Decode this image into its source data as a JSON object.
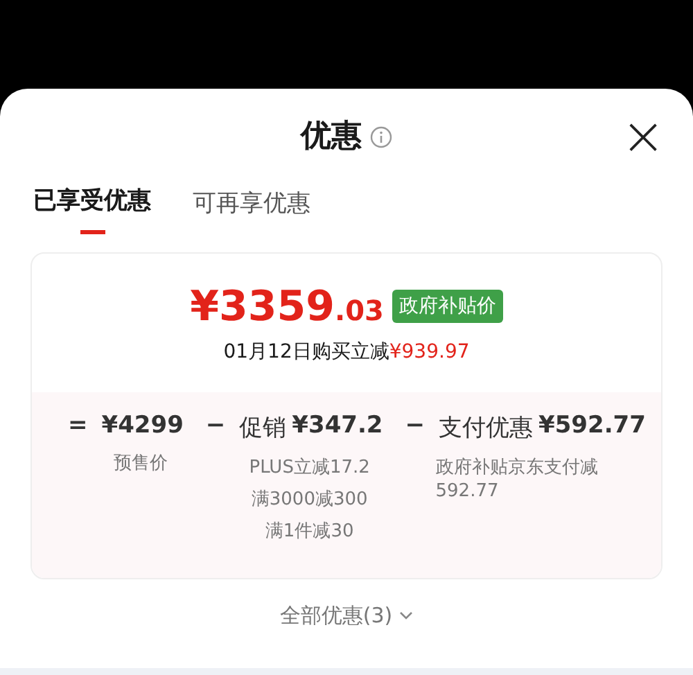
{
  "sheet": {
    "title": "优惠",
    "close": "×"
  },
  "tabs": [
    {
      "label": "已享受优惠",
      "selected": true
    },
    {
      "label": "可再享优惠",
      "selected": false
    }
  ],
  "summary": {
    "price": "¥3359",
    "price_decimal": ".03",
    "badge": "政府补贴价",
    "note": "01月12日购买立减",
    "saving": "¥939.97"
  },
  "breakdown": [
    {
      "operator": "=",
      "amount": "¥4299",
      "notes": [
        "预售价"
      ]
    },
    {
      "operator": "−",
      "label": "促销",
      "amount": "¥347.2",
      "notes": [
        "PLUS立减17.2",
        "满3000减300",
        "满1件减30"
      ]
    },
    {
      "operator": "−",
      "label": "支付优惠",
      "amount": "¥592.77",
      "notes": [
        "政府补贴京东支付减592.77"
      ]
    }
  ],
  "footer_link": "全部优惠(3)"
}
